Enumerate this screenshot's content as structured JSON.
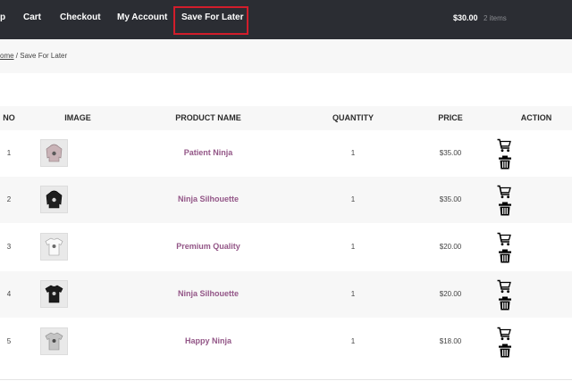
{
  "nav": {
    "items": [
      {
        "label": "p"
      },
      {
        "label": "Cart"
      },
      {
        "label": "Checkout"
      },
      {
        "label": "My Account"
      },
      {
        "label": "Save For Later"
      }
    ],
    "active_index": 4,
    "active_color": "#d21d2b",
    "cart_total": "$30.00",
    "cart_count": "2 items"
  },
  "breadcrumb": {
    "home": "ome",
    "separator": " / ",
    "current": "Save For Later"
  },
  "table": {
    "headers": {
      "no": "NO",
      "image": "IMAGE",
      "product_name": "PRODUCT NAME",
      "quantity": "QUANTITY",
      "price": "PRICE",
      "action": "ACTION"
    },
    "rows": [
      {
        "no": "1",
        "name": "Patient Ninja",
        "quantity": "1",
        "price": "$35.00",
        "image": "pink-hoodie"
      },
      {
        "no": "2",
        "name": "Ninja Silhouette",
        "quantity": "1",
        "price": "$35.00",
        "image": "black-hoodie"
      },
      {
        "no": "3",
        "name": "Premium Quality",
        "quantity": "1",
        "price": "$20.00",
        "image": "white-tshirt"
      },
      {
        "no": "4",
        "name": "Ninja Silhouette",
        "quantity": "1",
        "price": "$20.00",
        "image": "black-tshirt"
      },
      {
        "no": "5",
        "name": "Happy Ninja",
        "quantity": "1",
        "price": "$18.00",
        "image": "grey-tshirt"
      }
    ],
    "actions": {
      "add_to_cart_icon": "cart-icon",
      "remove_icon": "trash-icon"
    }
  },
  "colors": {
    "nav_bg": "#2b2d33",
    "product_link": "#935687"
  }
}
